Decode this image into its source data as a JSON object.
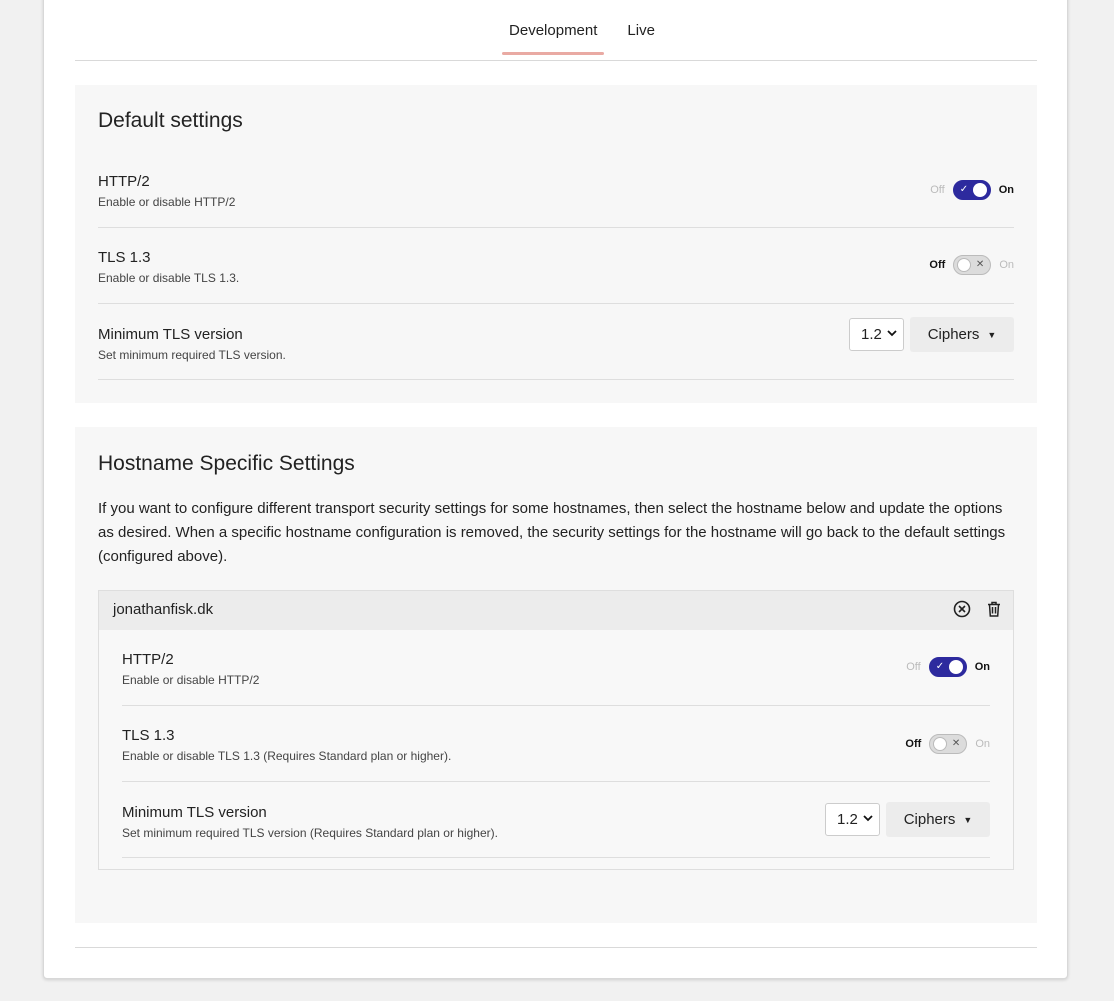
{
  "tabs": [
    {
      "label": "Development",
      "active": true
    },
    {
      "label": "Live",
      "active": false
    }
  ],
  "default_settings": {
    "title": "Default settings",
    "http2": {
      "title": "HTTP/2",
      "desc": "Enable or disable HTTP/2",
      "off_label": "Off",
      "on_label": "On",
      "enabled": true
    },
    "tls13": {
      "title": "TLS 1.3",
      "desc": "Enable or disable TLS 1.3.",
      "off_label": "Off",
      "on_label": "On",
      "enabled": false
    },
    "min_tls": {
      "title": "Minimum TLS version",
      "desc": "Set minimum required TLS version.",
      "value": "1.2",
      "ciphers_label": "Ciphers"
    }
  },
  "hostname_settings": {
    "title": "Hostname Specific Settings",
    "description": "If you want to configure different transport security settings for some hostnames, then select the hostname below and update the options as desired. When a specific hostname configuration is removed, the security settings for the hostname will go back to the default settings (configured above).",
    "hostname": "jonathanfisk.dk",
    "http2": {
      "title": "HTTP/2",
      "desc": "Enable or disable HTTP/2",
      "off_label": "Off",
      "on_label": "On",
      "enabled": true
    },
    "tls13": {
      "title": "TLS 1.3",
      "desc": "Enable or disable TLS 1.3 (Requires Standard plan or higher).",
      "off_label": "Off",
      "on_label": "On",
      "enabled": false
    },
    "min_tls": {
      "title": "Minimum TLS version",
      "desc": "Set minimum required TLS version (Requires Standard plan or higher).",
      "value": "1.2",
      "ciphers_label": "Ciphers"
    }
  },
  "colors": {
    "accent": "#2d2a9e",
    "tab_underline": "#e9aaa3"
  }
}
